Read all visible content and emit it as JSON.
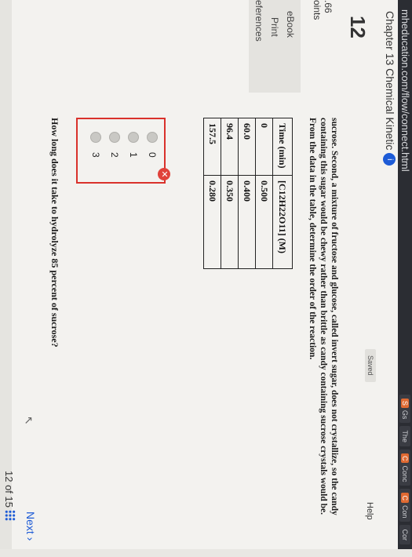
{
  "browser": {
    "url": "mheducation.com/flow/connect.html",
    "tabs": [
      "Gs",
      "The",
      "Conc",
      "Con",
      "Cor"
    ]
  },
  "header": {
    "chapter_title": "Chapter 13 Chemical Kinetic",
    "info_icon": "i",
    "saved_badge": "Saved",
    "help_label": "Help"
  },
  "question": {
    "number": "12",
    "points": ".66",
    "points_label": "oints",
    "text_lines": [
      "sucrose. Second, a mixture of fructose and glucose, called invert sugar, does not crystallize, so the candy",
      "containing this sugar would be chewy rather than brittle as candy containing sucrose crystals would be.",
      "From the data in the table, determine the order of the reaction."
    ],
    "prompt": "How long does it take to hydrolyze 85 percent of sucrose?"
  },
  "sidebar": {
    "items": [
      "eBook",
      "Print",
      "eferences"
    ]
  },
  "table": {
    "headers": [
      "Time (min)",
      "[C12H22O11] (M)"
    ],
    "rows": [
      [
        "0",
        "0.500"
      ],
      [
        "60.0",
        "0.400"
      ],
      [
        "96.4",
        "0.350"
      ],
      [
        "157.5",
        "0.280"
      ]
    ]
  },
  "answer": {
    "status_icon": "✕",
    "options": [
      "0",
      "1",
      "2",
      "3"
    ]
  },
  "footer": {
    "pager": "12 of 15",
    "next_label": "Next ›"
  },
  "colors": {
    "accent": "#1d5bd6",
    "error": "#d9312b",
    "topbar": "#2b2d33"
  }
}
